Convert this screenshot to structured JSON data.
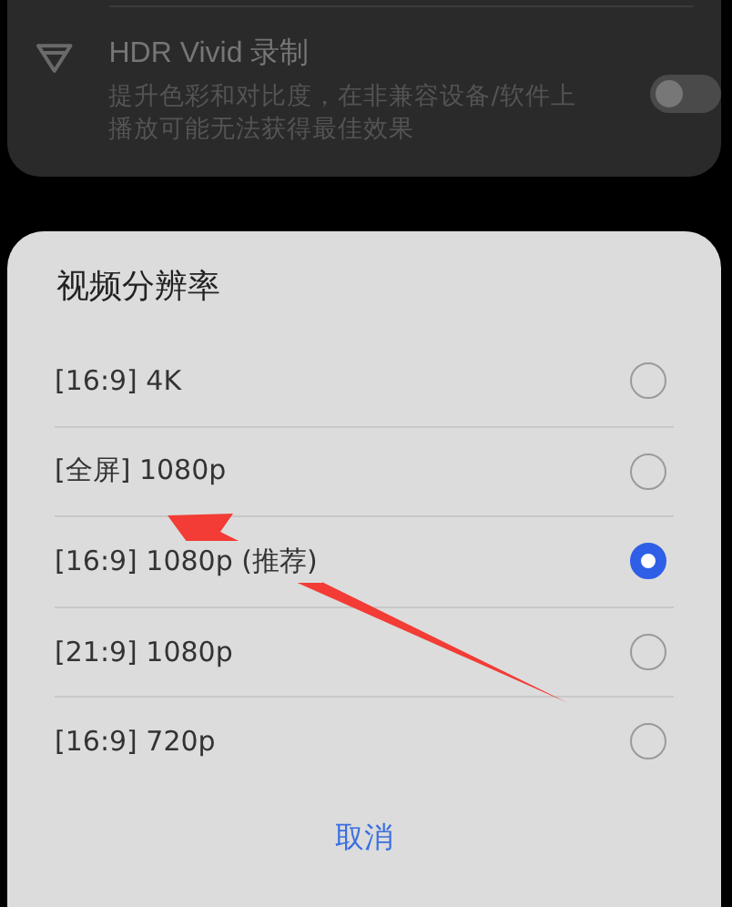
{
  "setting": {
    "title": "HDR Vivid 录制",
    "description": "提升色彩和对比度，在非兼容设备/软件上播放可能无法获得最佳效果",
    "on": false
  },
  "dialog": {
    "title": "视频分辨率",
    "options": [
      {
        "label": "[16:9] 4K",
        "selected": false
      },
      {
        "label": "[全屏] 1080p",
        "selected": false
      },
      {
        "label": "[16:9] 1080p (推荐)",
        "selected": true
      },
      {
        "label": "[21:9] 1080p",
        "selected": false
      },
      {
        "label": "[16:9] 720p",
        "selected": false
      }
    ],
    "cancel": "取消"
  }
}
